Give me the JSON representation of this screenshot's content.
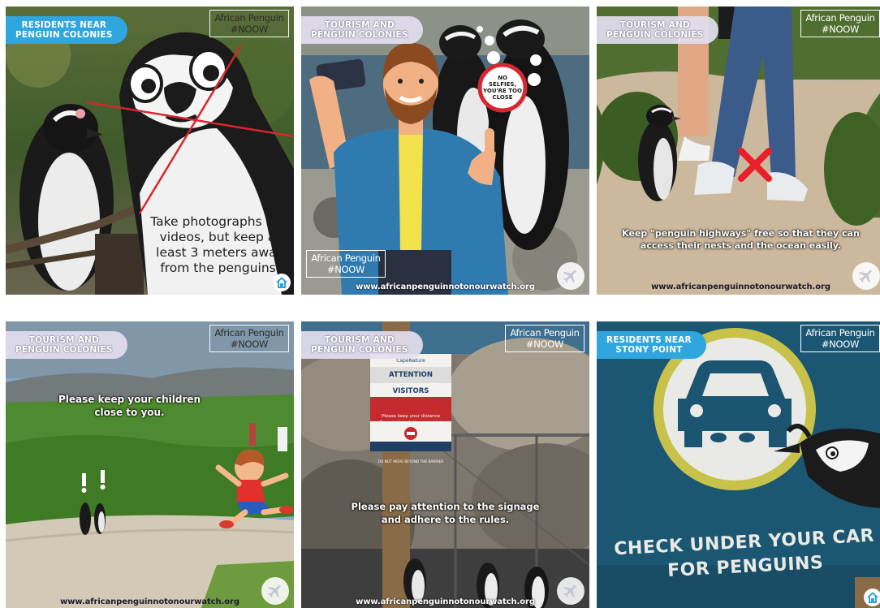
{
  "brand": {
    "line1": "African Penguin",
    "line2": "#NOOW"
  },
  "tiles": [
    {
      "tag_line1": "RESIDENTS NEAR",
      "tag_line2": "PENGUIN COLONIES",
      "caption": "Take photographs and videos, but keep at least 3 meters away from the penguins."
    },
    {
      "tag_line1": "TOURISM AND",
      "tag_line2": "PENGUIN COLONIES",
      "bubble": [
        "NO",
        "SELFIES,",
        "YOU'RE TOO",
        "CLOSE"
      ],
      "url": "www.africanpenguinnotonourwatch.org"
    },
    {
      "tag_line1": "TOURISM AND",
      "tag_line2": "PENGUIN COLONIES",
      "caption": "Keep \"penguin highways\" free so that they can access their nests and the ocean easily.",
      "url": "www.africanpenguinnotonourwatch.org"
    },
    {
      "tag_line1": "TOURISM AND",
      "tag_line2": "PENGUIN COLONIES",
      "caption": "Please keep your children close to you.",
      "url": "www.africanpenguinnotonourwatch.org"
    },
    {
      "tag_line1": "TOURISM AND",
      "tag_line2": "PENGUIN COLONIES",
      "caption": "Please pay attention to the signage and adhere to the rules.",
      "sign_brand": "CapeNature",
      "sign_title": "ATTENTION VISITORS",
      "sign_line1": "Please keep your distance",
      "sign_line2": "Do not disturb the penguins",
      "sign_line3": "DO NOT MOVE BEYOND THE BARRIER",
      "url": "www.africanpenguinnotonourwatch.org"
    },
    {
      "tag_line1": "RESIDENTS NEAR",
      "tag_line2": "STONY POINT",
      "sign_line1": "CHECK UNDER YOUR CAR",
      "sign_line2": "FOR PENGUINS"
    }
  ],
  "colors": {
    "tag_blue": "#2fa6dd",
    "cross_red": "#e8202a",
    "sign_teal": "#1b5772",
    "sign_yellow": "#c8c24a"
  }
}
